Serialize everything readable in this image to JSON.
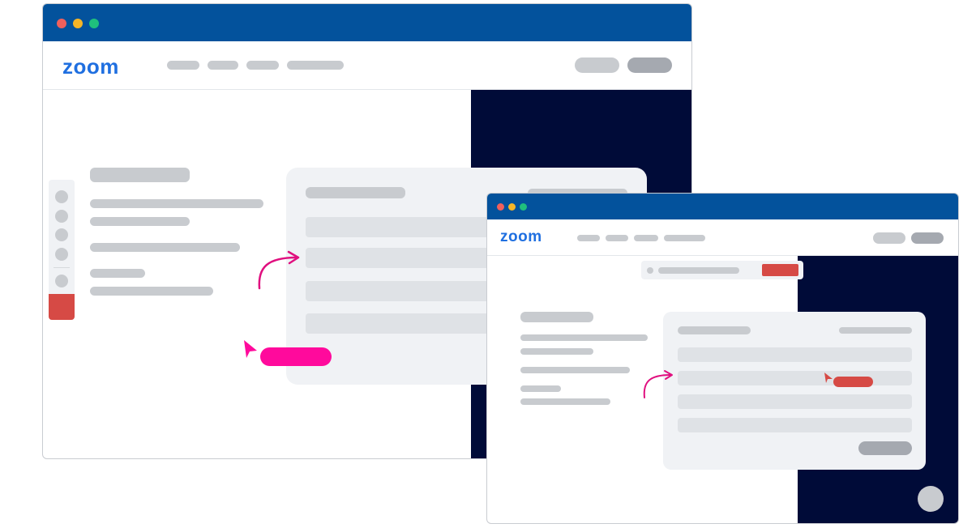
{
  "windows": {
    "back": {
      "logo": "zoom",
      "colors": {
        "titlebar": "#03529c",
        "navy_panel": "#000b38",
        "accent": "#ff0a9c",
        "sidebar_active": "#d64a45"
      },
      "icons": [
        "close-dot",
        "minimize-dot",
        "maximize-dot",
        "cursor-arrow-icon",
        "curved-arrow-icon"
      ]
    },
    "front": {
      "logo": "zoom",
      "colors": {
        "accent": "#d64a45",
        "highlight_arrow": "#e0107f"
      },
      "icons": [
        "close-dot",
        "minimize-dot",
        "maximize-dot",
        "cursor-arrow-icon",
        "curved-arrow-icon",
        "chat-bubble-icon"
      ]
    }
  }
}
